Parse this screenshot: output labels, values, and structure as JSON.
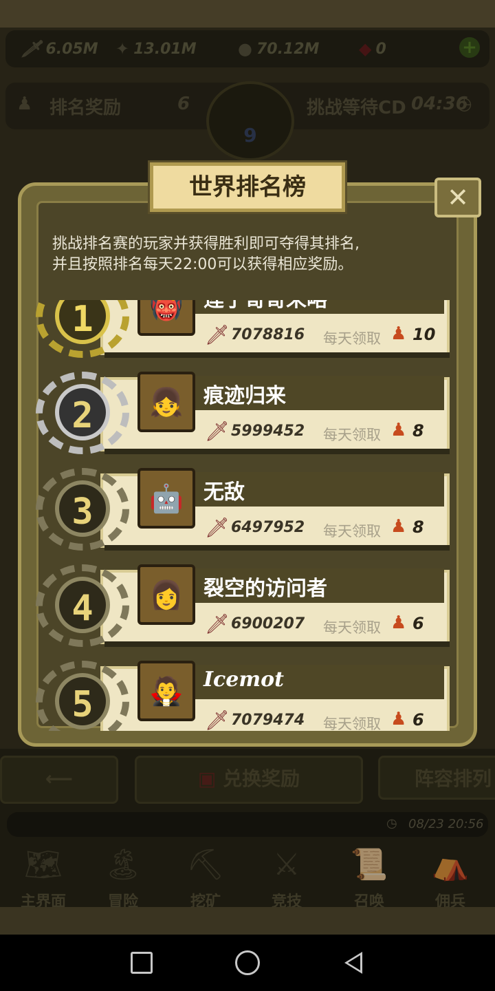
{
  "top_stats": [
    {
      "icon": "sword-icon",
      "value": "6.05M"
    },
    {
      "icon": "exp-icon",
      "value": "13.01M"
    },
    {
      "icon": "gold-icon",
      "value": "70.12M"
    },
    {
      "icon": "gem-icon",
      "value": "0"
    }
  ],
  "rank_bar": {
    "reward_label": "排名奖励",
    "reward_value": "6",
    "emblem_rank": "9",
    "cd_label": "挑战等待CD",
    "cd_value": "04:36"
  },
  "dialog": {
    "title": "世界排名榜",
    "close": "✕",
    "description_line1": "挑战排名赛的玩家并获得胜利即可夺得其排名,",
    "description_line2": "并且按照排名每天22:00可以获得相应奖励。",
    "daily_label": "每天领取",
    "entries": [
      {
        "rank": "1",
        "name": "莲子哥哥来略",
        "power": "7078816",
        "reward": "10"
      },
      {
        "rank": "2",
        "name": "痕迹归来",
        "power": "5999452",
        "reward": "8"
      },
      {
        "rank": "3",
        "name": "无敌",
        "power": "6497952",
        "reward": "8"
      },
      {
        "rank": "4",
        "name": "裂空的访问者",
        "power": "6900207",
        "reward": "6"
      },
      {
        "rank": "5",
        "name": "Icemot",
        "power": "7079474",
        "reward": "6"
      }
    ]
  },
  "bottom_buttons": {
    "exchange": "兑换奖励",
    "lineup": "阵容排列"
  },
  "timestamp": "08/23 20:56",
  "nav": [
    {
      "label": "主界面",
      "icon": "map-icon"
    },
    {
      "label": "冒险",
      "icon": "island-icon"
    },
    {
      "label": "挖矿",
      "icon": "pickaxe-icon"
    },
    {
      "label": "竞技",
      "icon": "crossed-swords-icon"
    },
    {
      "label": "召唤",
      "icon": "scroll-icon"
    },
    {
      "label": "佣兵",
      "icon": "tent-icon"
    }
  ],
  "colors": {
    "gold_medal": "#d9c24a",
    "silver_medal": "#c9c9c9",
    "bronze_medal": "#8d8662",
    "title_plate": "#efdba0",
    "card": "#efe6c4"
  }
}
